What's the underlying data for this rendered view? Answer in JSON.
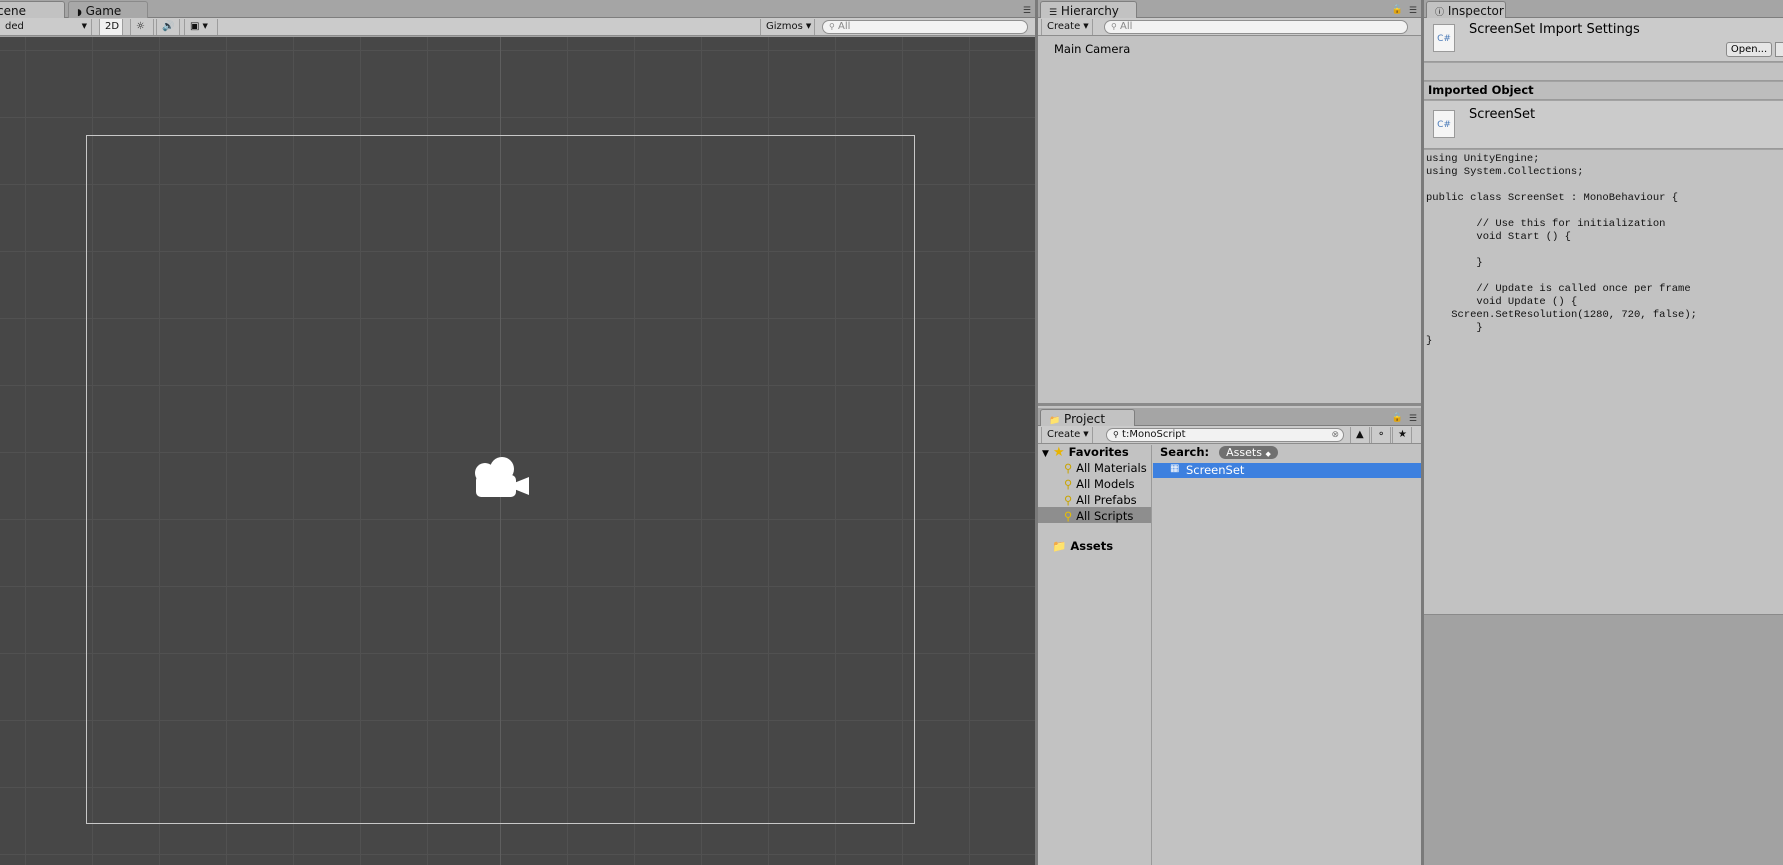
{
  "scene_panel": {
    "tabs": [
      {
        "label": "cene",
        "icon": "grid-icon"
      },
      {
        "label": "Game",
        "icon": "pacman-icon"
      }
    ],
    "shading_mode": "ded",
    "mode_2d": "2D",
    "gizmos_label": "Gizmos",
    "search_placeholder": "All",
    "camera_icon": "camera-icon"
  },
  "hierarchy_panel": {
    "tab_label": "Hierarchy",
    "create_label": "Create",
    "search_placeholder": "All",
    "items": [
      "Main Camera"
    ]
  },
  "project_panel": {
    "tab_label": "Project",
    "create_label": "Create",
    "search_value": "t:MonoScript",
    "favorites_label": "Favorites",
    "favorites": [
      "All Materials",
      "All Models",
      "All Prefabs",
      "All Scripts"
    ],
    "selected_favorite": "All Scripts",
    "assets_label": "Assets",
    "search_label": "Search:",
    "search_scope": "Assets",
    "results": [
      "ScreenSet"
    ]
  },
  "inspector_panel": {
    "tab_label": "Inspector",
    "header_title": "ScreenSet Import Settings",
    "open_button": "Open...",
    "section_title": "Imported Object",
    "object_name": "ScreenSet",
    "file_icon_label": "C#",
    "code": "using UnityEngine;\nusing System.Collections;\n\npublic class ScreenSet : MonoBehaviour {\n\n\t\t// Use this for initialization\n\t\tvoid Start () {\n\n\t\t}\n\n\t\t// Update is called once per frame\n\t\tvoid Update () {\n\tScreen.SetResolution(1280, 720, false);\n\t\t}\n}"
  },
  "colors": {
    "scene_bg": "#474747",
    "selection": "#3d80df",
    "panel_bg": "#c2c2c2"
  }
}
